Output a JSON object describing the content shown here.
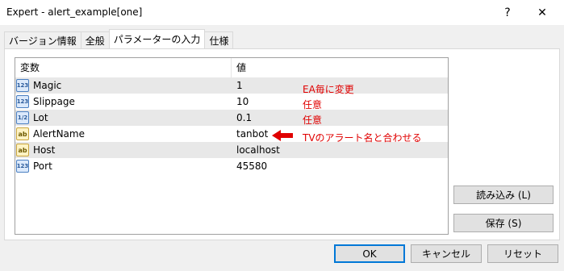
{
  "window": {
    "title": "Expert - alert_example[one]",
    "help_glyph": "?",
    "close_glyph": "✕"
  },
  "tabs": [
    {
      "label": "バージョン情報",
      "active": false
    },
    {
      "label": "全般",
      "active": false
    },
    {
      "label": "パラメーターの入力",
      "active": true
    },
    {
      "label": "仕様",
      "active": false
    }
  ],
  "grid": {
    "headers": {
      "variable": "変数",
      "value": "値"
    },
    "rows": [
      {
        "type_icon": "123",
        "name": "Magic",
        "value": "1"
      },
      {
        "type_icon": "123",
        "name": "Slippage",
        "value": "10"
      },
      {
        "type_icon": "1/2",
        "name": "Lot",
        "value": "0.1"
      },
      {
        "type_icon": "ab",
        "name": "AlertName",
        "value": "tanbot"
      },
      {
        "type_icon": "ab",
        "name": "Host",
        "value": "localhost"
      },
      {
        "type_icon": "123",
        "name": "Port",
        "value": "45580"
      }
    ]
  },
  "annotations": {
    "magic": "EA毎に変更",
    "slippage": "任意",
    "lot": "任意",
    "alertname": "TVのアラート名と合わせる",
    "color": "#e00000"
  },
  "buttons": {
    "load": "読み込み (L)",
    "save": "保存 (S)",
    "ok": "OK",
    "cancel": "キャンセル",
    "reset": "リセット"
  }
}
